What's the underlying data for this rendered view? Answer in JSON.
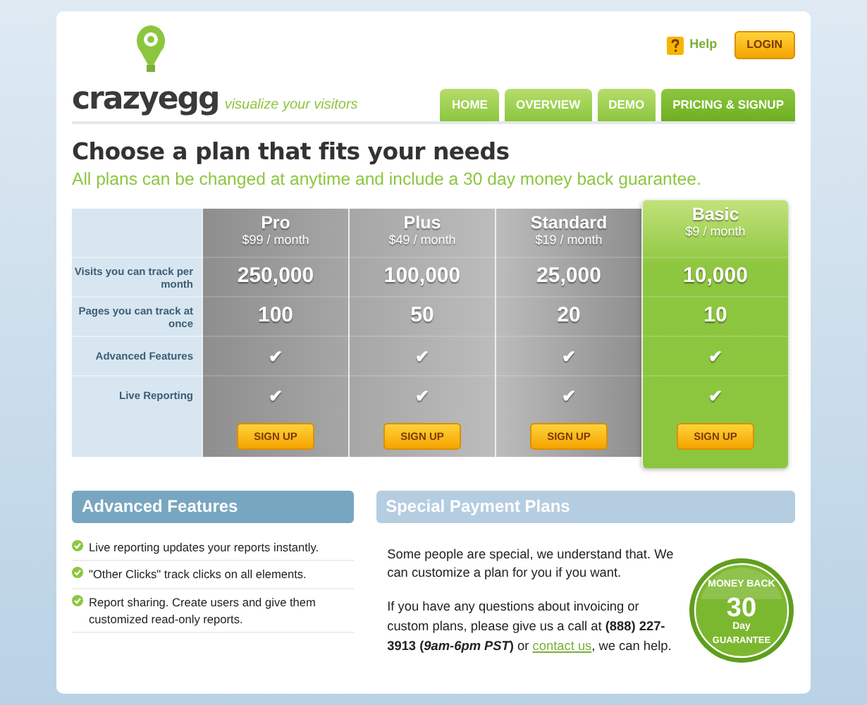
{
  "header": {
    "logo": "crazyegg",
    "tagline": "visualize your visitors",
    "help": "Help",
    "login": "LOGIN",
    "nav": [
      {
        "label": "HOME",
        "selected": false
      },
      {
        "label": "OVERVIEW",
        "selected": false
      },
      {
        "label": "DEMO",
        "selected": false
      },
      {
        "label": "PRICING & SIGNUP",
        "selected": true
      }
    ]
  },
  "heading": "Choose a plan that fits your needs",
  "subheading": "All plans can be changed at anytime and include a 30 day money back guarantee.",
  "pricing_table": {
    "features": [
      "Visits you can track per month",
      "Pages you can track at once",
      "Advanced Features",
      "Live Reporting"
    ],
    "plans": [
      {
        "name": "Pro",
        "price": "$99 / month",
        "values": [
          "250,000",
          "100",
          "✔",
          "✔"
        ],
        "button": "SIGN UP",
        "featured": false
      },
      {
        "name": "Plus",
        "price": "$49 / month",
        "values": [
          "100,000",
          "50",
          "✔",
          "✔"
        ],
        "button": "SIGN UP",
        "featured": false
      },
      {
        "name": "Standard",
        "price": "$19 / month",
        "values": [
          "25,000",
          "20",
          "✔",
          "✔"
        ],
        "button": "SIGN UP",
        "featured": false
      },
      {
        "name": "Basic",
        "price": "$9 / month",
        "values": [
          "10,000",
          "10",
          "✔",
          "✔"
        ],
        "button": "SIGN UP",
        "featured": true
      }
    ]
  },
  "advanced_features": {
    "title": "Advanced Features",
    "items": [
      "Live reporting updates your reports instantly.",
      "\"Other Clicks\" track clicks on all elements.",
      "Report sharing. Create users and give them customized read-only reports."
    ]
  },
  "special_payment": {
    "title": "Special Payment Plans",
    "paragraph_1": "Some people are special, we understand that. We can customize a plan for you if you want.",
    "paragraph_2": "If you have any questions about invoicing or custom plans, please give us a call at **(888) 227-3913 (*9am-6pm PST*)** or",
    "link": "contact us",
    "after_link": ", we can help."
  },
  "badge": {
    "top": "MONEY BACK",
    "number": "30",
    "unit": "Day",
    "bottom": "GUARANTEE"
  }
}
